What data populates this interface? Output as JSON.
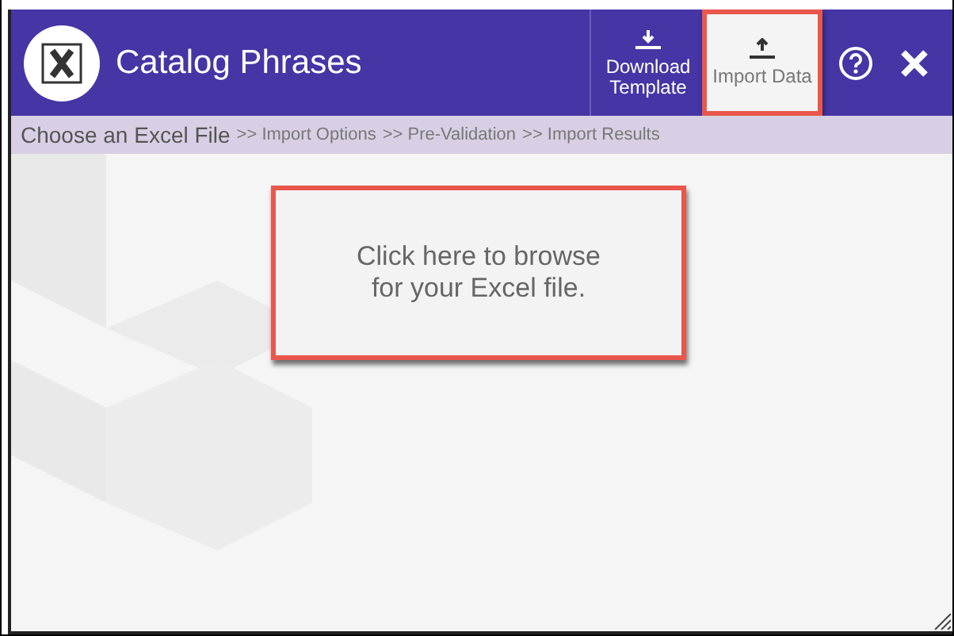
{
  "window": {
    "title": "Catalog Phrases"
  },
  "toolbar": [
    {
      "label": "Download Template",
      "kind": "download",
      "selected": false
    },
    {
      "label": "Import Data",
      "kind": "upload",
      "selected": true
    }
  ],
  "breadcrumb": [
    {
      "label": "Choose an Excel File",
      "selected": true
    },
    {
      "label": ">> Import Options",
      "selected": false
    },
    {
      "label": ">> Pre-Validation",
      "selected": false
    },
    {
      "label": ">> Import Results",
      "selected": false
    }
  ],
  "browse_prompt": "Click here to browse for your Excel file."
}
